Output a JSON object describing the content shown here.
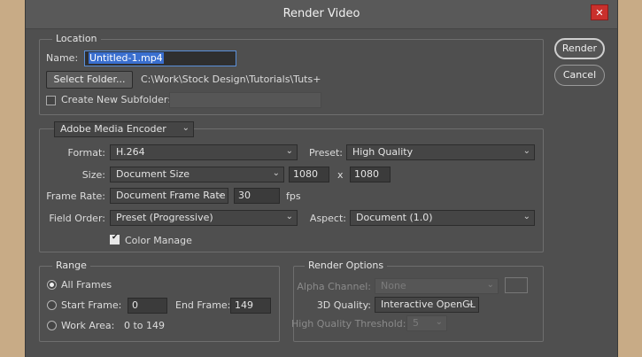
{
  "window": {
    "title": "Render Video",
    "close_glyph": "✕"
  },
  "buttons": {
    "render": "Render",
    "cancel": "Cancel"
  },
  "location": {
    "group_title": "Location",
    "name_label": "Name:",
    "name_value": "Untitled-1.mp4",
    "select_folder": "Select Folder...",
    "folder_path": "C:\\Work\\Stock Design\\Tutorials\\Tuts+",
    "create_subfolder_label": "Create New Subfolder:",
    "create_subfolder_checked": false,
    "subfolder_value": ""
  },
  "encoder": {
    "selected": "Adobe Media Encoder",
    "format_label": "Format:",
    "format_value": "H.264",
    "preset_label": "Preset:",
    "preset_value": "High Quality",
    "size_label": "Size:",
    "size_value": "Document Size",
    "width": "1080",
    "times": "x",
    "height": "1080",
    "frame_rate_label": "Frame Rate:",
    "frame_rate_value": "Document Frame Rate",
    "fps_value": "30",
    "fps_unit": "fps",
    "field_order_label": "Field Order:",
    "field_order_value": "Preset (Progressive)",
    "aspect_label": "Aspect:",
    "aspect_value": "Document (1.0)",
    "color_manage_label": "Color Manage",
    "color_manage_checked": true
  },
  "range": {
    "group_title": "Range",
    "all_frames": "All Frames",
    "start_frame_label": "Start Frame:",
    "start_frame_value": "0",
    "end_frame_label": "End Frame:",
    "end_frame_value": "149",
    "work_area_label": "Work Area:",
    "work_area_value": "0 to 149",
    "selected": "All Frames"
  },
  "render_options": {
    "group_title": "Render Options",
    "alpha_channel_label": "Alpha Channel:",
    "alpha_channel_value": "None",
    "quality_3d_label": "3D Quality:",
    "quality_3d_value": "Interactive OpenGL",
    "threshold_label": "High Quality Threshold:",
    "threshold_value": "5"
  },
  "icons": {
    "dropdown": "chevron-down-icon",
    "close": "close-icon"
  }
}
